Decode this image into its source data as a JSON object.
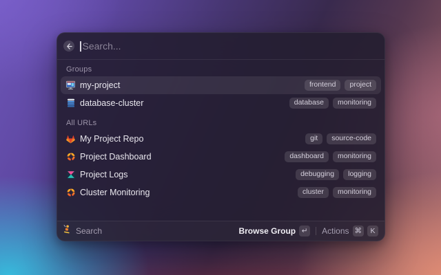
{
  "search": {
    "placeholder": "Search..."
  },
  "sections": [
    {
      "header": "Groups",
      "items": [
        {
          "title": "my-project",
          "icon": "desktop-computer",
          "tags": [
            "frontend",
            "project"
          ],
          "selected": true
        },
        {
          "title": "database-cluster",
          "icon": "database",
          "tags": [
            "database",
            "monitoring"
          ],
          "selected": false
        }
      ]
    },
    {
      "header": "All URLs",
      "items": [
        {
          "title": "My Project Repo",
          "icon": "gitlab",
          "tags": [
            "git",
            "source-code"
          ],
          "selected": false
        },
        {
          "title": "Project Dashboard",
          "icon": "grafana",
          "tags": [
            "dashboard",
            "monitoring"
          ],
          "selected": false
        },
        {
          "title": "Project Logs",
          "icon": "kibana",
          "tags": [
            "debugging",
            "logging"
          ],
          "selected": false
        },
        {
          "title": "Cluster Monitoring",
          "icon": "grafana",
          "tags": [
            "cluster",
            "monitoring"
          ],
          "selected": false
        }
      ]
    }
  ],
  "footer": {
    "app_icon": "mascot",
    "left_label": "Search",
    "primary_action": {
      "label": "Browse Group",
      "key": "↵"
    },
    "secondary_action": {
      "label": "Actions",
      "keys": [
        "⌘",
        "K"
      ]
    }
  },
  "colors": {
    "selection_highlight": "rgba(255,255,255,0.08)",
    "tag_background": "rgba(255,255,255,0.12)",
    "gitlab_orange": "#fc6d26",
    "grafana_orange": "#f3702a",
    "kibana_pink": "#ef5098",
    "kibana_teal": "#27c0b2",
    "database_blue": "#4187d0"
  }
}
